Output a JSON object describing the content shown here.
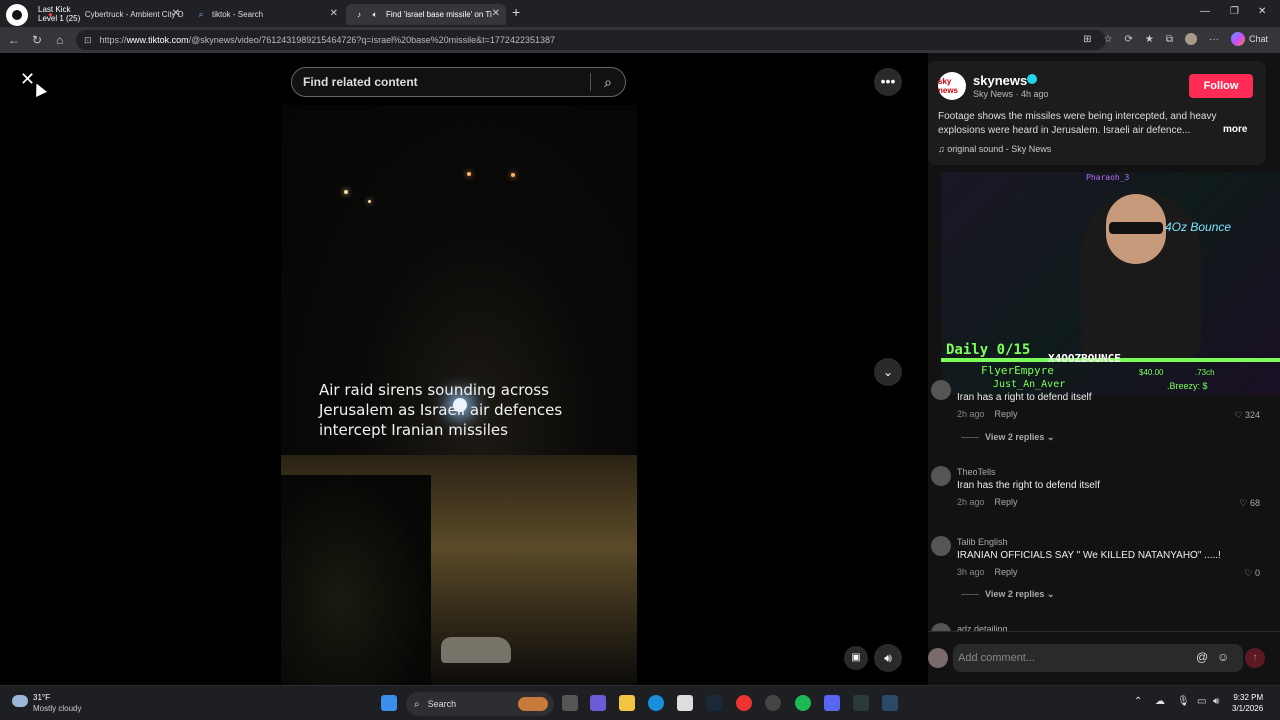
{
  "browser": {
    "overlay": {
      "line1": "Last Kick",
      "line2": "Level 1  (25)"
    },
    "tabs": [
      {
        "label": "Cybertruck - Ambient City D",
        "icon": "music-note-icon"
      },
      {
        "label": "tiktok - Search",
        "icon": "search-icon"
      },
      {
        "label": "Find 'israel base missile' on Ti",
        "icon": "tiktok-icon",
        "active": true
      }
    ],
    "url_prefix": "https://",
    "url_domain": "www.tiktok.com",
    "url_path": "/@skynews/video/7612431989215464726?q=israel%20base%20missile&t=1772422351387",
    "chat_label": "Chat"
  },
  "search": {
    "placeholder": "Find related content"
  },
  "video": {
    "caption": "Air raid sirens sounding across Jerusalem as Israeli air defences intercept Iranian missiles"
  },
  "author": {
    "avatar_text": "sky news",
    "name": "skynews",
    "subtitle": "Sky News · 4h ago",
    "follow_label": "Follow",
    "description": "Footage shows the missiles were being intercepted, and heavy explosions were heard in Jerusalem. Israeli air defence...",
    "more_label": "more",
    "sound": "original sound - Sky News"
  },
  "webcam": {
    "top_name": "Pharaoh_3",
    "brand": "4Oz Bounce",
    "daily": "Daily 0/15",
    "streamer": "X4OOZBOUNCE",
    "donor1": "FlyerEmpyre",
    "donor2": "Just_An_Aver",
    "amount1": "$40.00",
    "amount2": ".73ch",
    "amount3": ".Breezy: $"
  },
  "comments": [
    {
      "user": "",
      "text": "Iran has a right to defend itself",
      "time": "2h ago",
      "reply": "Reply",
      "likes": "324",
      "view_replies": "View 2 replies"
    },
    {
      "user": "TheoTells",
      "text": "Iran has the right to defend itself",
      "time": "2h ago",
      "reply": "Reply",
      "likes": "68"
    },
    {
      "user": "Talib English",
      "text": "IRANIAN OFFICIALS SAY \" We KILLED NATANYAHO\" .....!",
      "time": "3h ago",
      "reply": "Reply",
      "likes": "0",
      "view_replies": "View 2 replies"
    },
    {
      "user": "adz detailing"
    }
  ],
  "comment_input": {
    "placeholder": "Add comment..."
  },
  "taskbar": {
    "temp": "31°F",
    "weather": "Mostly cloudy",
    "search_label": "Search",
    "time": "9:32 PM",
    "date": "3/1/2026"
  }
}
